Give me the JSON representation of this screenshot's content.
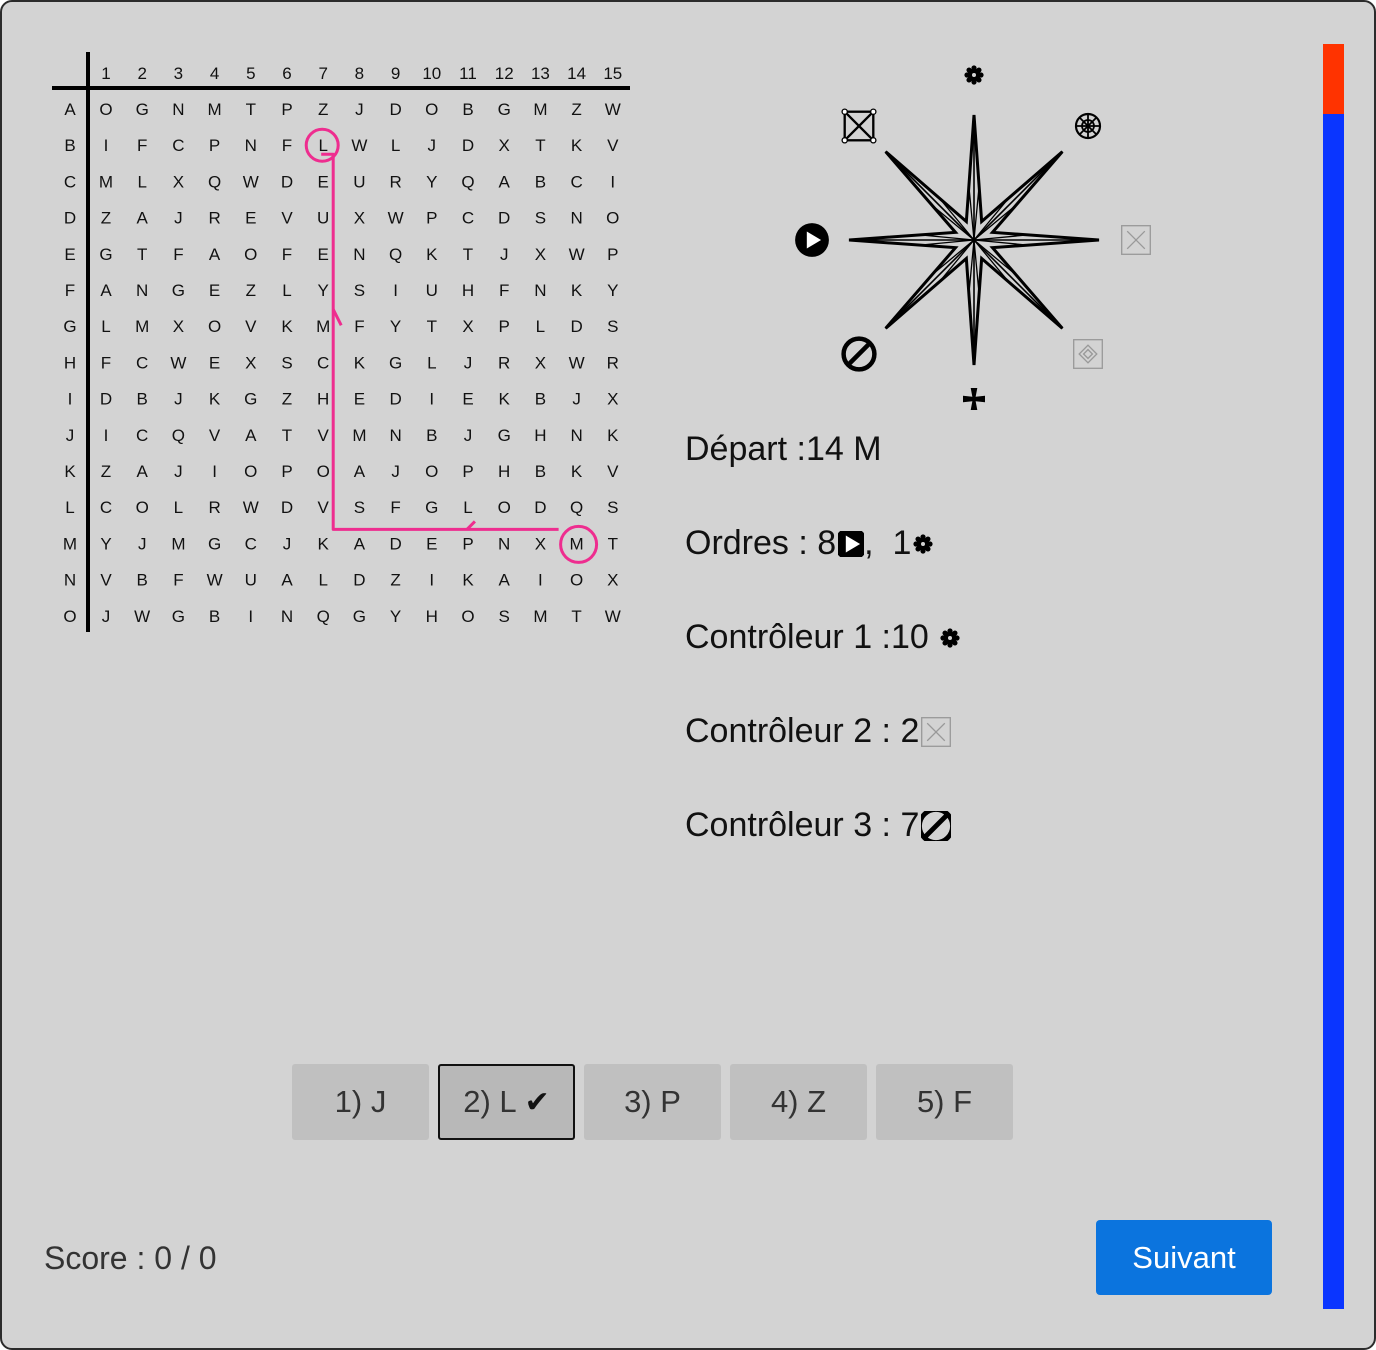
{
  "grid": {
    "col_labels": [
      "1",
      "2",
      "3",
      "4",
      "5",
      "6",
      "7",
      "8",
      "9",
      "10",
      "11",
      "12",
      "13",
      "14",
      "15"
    ],
    "row_labels": [
      "A",
      "B",
      "C",
      "D",
      "E",
      "F",
      "G",
      "H",
      "I",
      "J",
      "K",
      "L",
      "M",
      "N",
      "O"
    ],
    "rows": [
      [
        "O",
        "G",
        "N",
        "M",
        "T",
        "P",
        "Z",
        "J",
        "D",
        "O",
        "B",
        "G",
        "M",
        "Z",
        "W"
      ],
      [
        "I",
        "F",
        "C",
        "P",
        "N",
        "F",
        "L",
        "W",
        "L",
        "J",
        "D",
        "X",
        "T",
        "K",
        "V"
      ],
      [
        "M",
        "L",
        "X",
        "Q",
        "W",
        "D",
        "E",
        "U",
        "R",
        "Y",
        "Q",
        "A",
        "B",
        "C",
        "I"
      ],
      [
        "Z",
        "A",
        "J",
        "R",
        "E",
        "V",
        "U",
        "X",
        "W",
        "P",
        "C",
        "D",
        "S",
        "N",
        "O"
      ],
      [
        "G",
        "T",
        "F",
        "A",
        "O",
        "F",
        "E",
        "N",
        "Q",
        "K",
        "T",
        "J",
        "X",
        "W",
        "P"
      ],
      [
        "A",
        "N",
        "G",
        "E",
        "Z",
        "L",
        "Y",
        "S",
        "I",
        "U",
        "H",
        "F",
        "N",
        "K",
        "Y"
      ],
      [
        "L",
        "M",
        "X",
        "O",
        "V",
        "K",
        "M",
        "F",
        "Y",
        "T",
        "X",
        "P",
        "L",
        "D",
        "S"
      ],
      [
        "F",
        "C",
        "W",
        "E",
        "X",
        "S",
        "C",
        "K",
        "G",
        "L",
        "J",
        "R",
        "X",
        "W",
        "R"
      ],
      [
        "D",
        "B",
        "J",
        "K",
        "G",
        "Z",
        "H",
        "E",
        "D",
        "I",
        "E",
        "K",
        "B",
        "J",
        "X"
      ],
      [
        "I",
        "C",
        "Q",
        "V",
        "A",
        "T",
        "V",
        "M",
        "N",
        "B",
        "J",
        "G",
        "H",
        "N",
        "K"
      ],
      [
        "Z",
        "A",
        "J",
        "I",
        "O",
        "P",
        "O",
        "A",
        "J",
        "O",
        "P",
        "H",
        "B",
        "K",
        "V"
      ],
      [
        "C",
        "O",
        "L",
        "R",
        "W",
        "D",
        "V",
        "S",
        "F",
        "G",
        "L",
        "O",
        "D",
        "Q",
        "S"
      ],
      [
        "Y",
        "J",
        "M",
        "G",
        "C",
        "J",
        "K",
        "A",
        "D",
        "E",
        "P",
        "N",
        "X",
        "M",
        "T"
      ],
      [
        "V",
        "B",
        "F",
        "W",
        "U",
        "A",
        "L",
        "D",
        "Z",
        "I",
        "K",
        "A",
        "I",
        "O",
        "X"
      ],
      [
        "J",
        "W",
        "G",
        "B",
        "I",
        "N",
        "Q",
        "G",
        "Y",
        "H",
        "O",
        "S",
        "M",
        "T",
        "W"
      ]
    ],
    "path": {
      "color": "#ee2d8f",
      "start": {
        "row": "M",
        "col": 14
      },
      "end": {
        "row": "B",
        "col": 7
      },
      "moves": [
        {
          "direction": "west",
          "steps": 7
        },
        {
          "direction": "north",
          "steps": 11
        }
      ]
    }
  },
  "compass": {
    "symbols": [
      {
        "direction": "north",
        "icon": "gear-icon"
      },
      {
        "direction": "north-east",
        "icon": "wheel-icon"
      },
      {
        "direction": "east",
        "icon": "crossed-box-icon"
      },
      {
        "direction": "south-east",
        "icon": "diamond-box-icon"
      },
      {
        "direction": "south",
        "icon": "cross-pattee-icon"
      },
      {
        "direction": "south-west",
        "icon": "prohibited-icon"
      },
      {
        "direction": "west",
        "icon": "play-circle-icon"
      },
      {
        "direction": "north-west",
        "icon": "node-box-icon"
      }
    ]
  },
  "info": {
    "depart": "Départ :14 M",
    "ordres_prefix": "Ordres : 8",
    "ordres_middle": ",  1",
    "controleur1": "Contrôleur 1 :10 ",
    "controleur2": "Contrôleur 2 : 2",
    "controleur3": "Contrôleur 3 : 7"
  },
  "choices": [
    {
      "label": "1) J",
      "selected": false
    },
    {
      "label": "2) L",
      "selected": true
    },
    {
      "label": "3) P",
      "selected": false
    },
    {
      "label": "4) Z",
      "selected": false
    },
    {
      "label": "5) F",
      "selected": false
    }
  ],
  "check_mark": "✔",
  "score": "Score : 0 / 0",
  "next_button": "Suivant",
  "timer": {
    "elapsed_fraction": 0.055,
    "elapsed_color": "#ff3300",
    "remaining_color": "#0a35ff"
  }
}
